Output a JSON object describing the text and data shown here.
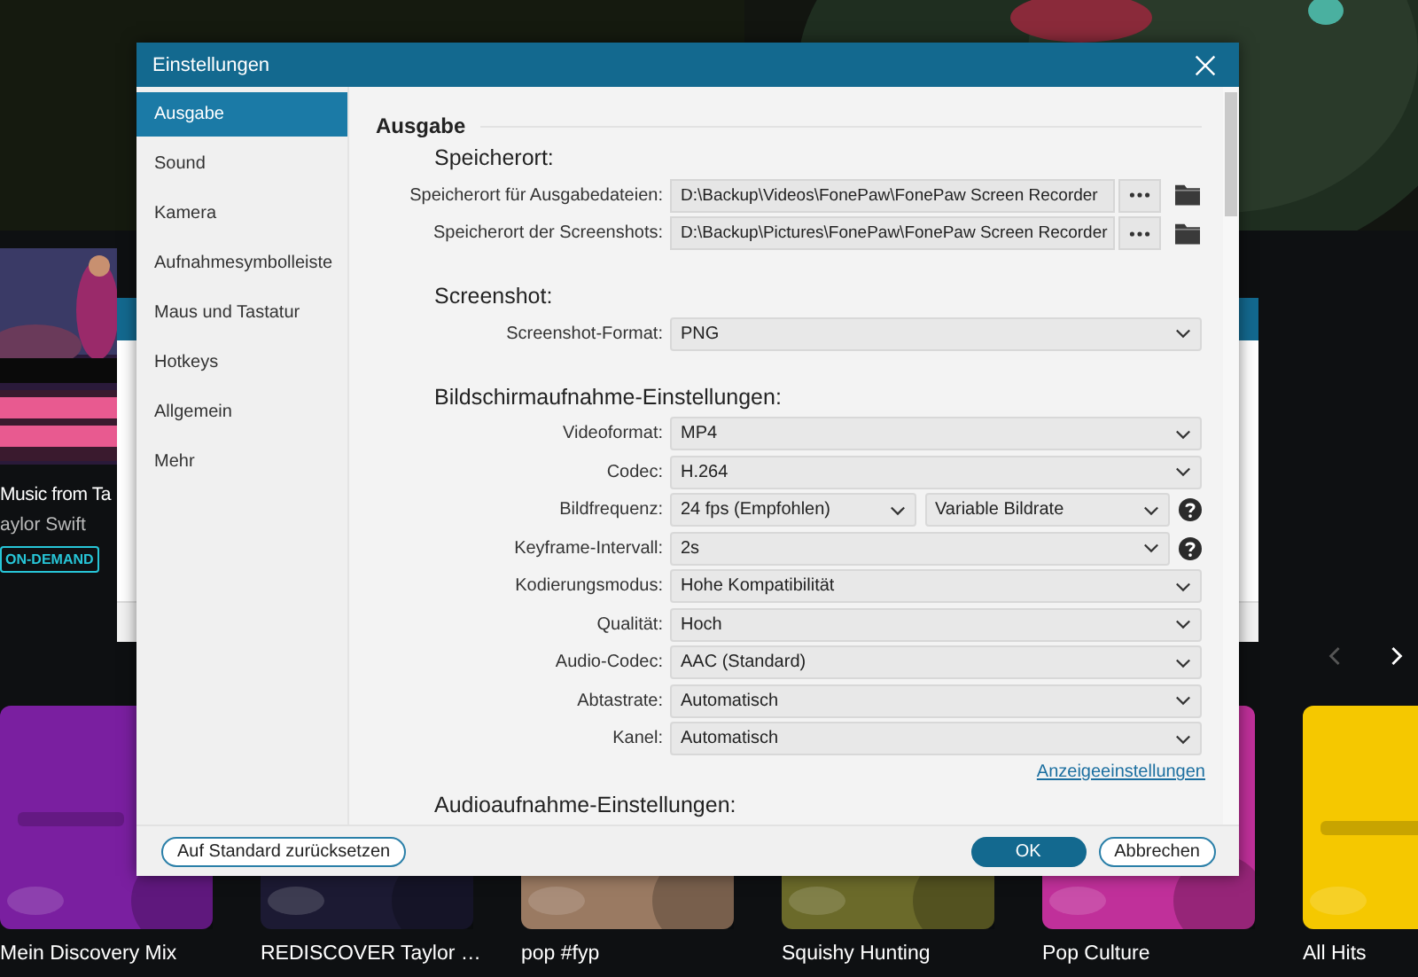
{
  "background": {
    "featured": {
      "title": "Music from Ta",
      "artist": "aylor Swift",
      "badge": "ON-DEMAND"
    },
    "carousel": {
      "prev_disabled": true,
      "next_disabled": false
    },
    "cards": [
      {
        "title": "Mein Discovery Mix",
        "color": "#7a1fa0"
      },
      {
        "title": "REDISCOVER Taylor …",
        "color": "#1c1a33"
      },
      {
        "title": "pop #fyp",
        "color": "#9a7a62"
      },
      {
        "title": "Squishy Hunting",
        "color": "#6b6a2a"
      },
      {
        "title": "Pop Culture",
        "color": "#c0309a"
      },
      {
        "title": "All Hits",
        "color": "#f5c800"
      }
    ]
  },
  "dialog": {
    "title": "Einstellungen",
    "sidebar": [
      {
        "label": "Ausgabe",
        "selected": true
      },
      {
        "label": "Sound",
        "selected": false
      },
      {
        "label": "Kamera",
        "selected": false
      },
      {
        "label": "Aufnahmesymbolleiste",
        "selected": false
      },
      {
        "label": "Maus und Tastatur",
        "selected": false
      },
      {
        "label": "Hotkeys",
        "selected": false
      },
      {
        "label": "Allgemein",
        "selected": false
      },
      {
        "label": "Mehr",
        "selected": false
      }
    ],
    "section": "Ausgabe",
    "groups": [
      {
        "heading": "Speicherort:",
        "rows": [
          {
            "kind": "path",
            "label": "Speicherort für Ausgabedateien:",
            "value": "D:\\Backup\\Videos\\FonePaw\\FonePaw Screen Recorder"
          },
          {
            "kind": "path",
            "label": "Speicherort der Screenshots:",
            "value": "D:\\Backup\\Pictures\\FonePaw\\FonePaw Screen Recorder"
          }
        ]
      },
      {
        "heading": "Screenshot:",
        "rows": [
          {
            "kind": "select",
            "label": "Screenshot-Format:",
            "values": [
              "PNG"
            ],
            "help": false
          }
        ]
      },
      {
        "heading": "Bildschirmaufnahme-Einstellungen:",
        "rows": [
          {
            "kind": "select",
            "label": "Videoformat:",
            "values": [
              "MP4"
            ],
            "help": false
          },
          {
            "kind": "select",
            "label": "Codec:",
            "values": [
              "H.264"
            ],
            "help": false
          },
          {
            "kind": "select",
            "label": "Bildfrequenz:",
            "values": [
              "24 fps (Empfohlen)",
              "Variable Bildrate"
            ],
            "help": true
          },
          {
            "kind": "select",
            "label": "Keyframe-Intervall:",
            "values": [
              "2s"
            ],
            "help": true
          },
          {
            "kind": "select",
            "label": "Kodierungsmodus:",
            "values": [
              "Hohe Kompatibilität"
            ],
            "help": false
          },
          {
            "kind": "select",
            "label": "Qualität:",
            "values": [
              "Hoch"
            ],
            "help": false
          },
          {
            "kind": "select",
            "label": "Audio-Codec:",
            "values": [
              "AAC (Standard)"
            ],
            "help": false
          },
          {
            "kind": "select",
            "label": "Abtastrate:",
            "values": [
              "Automatisch"
            ],
            "help": false
          },
          {
            "kind": "select",
            "label": "Kanel:",
            "values": [
              "Automatisch"
            ],
            "help": false
          }
        ]
      }
    ],
    "link": "Anzeigeeinstellungen",
    "next_heading": "Audioaufnahme-Einstellungen:",
    "buttons": [
      {
        "label": "Auf Standard zurücksetzen",
        "kind": "secondary"
      },
      {
        "label": "OK",
        "kind": "primary"
      },
      {
        "label": "Abbrechen",
        "kind": "secondary"
      }
    ]
  }
}
